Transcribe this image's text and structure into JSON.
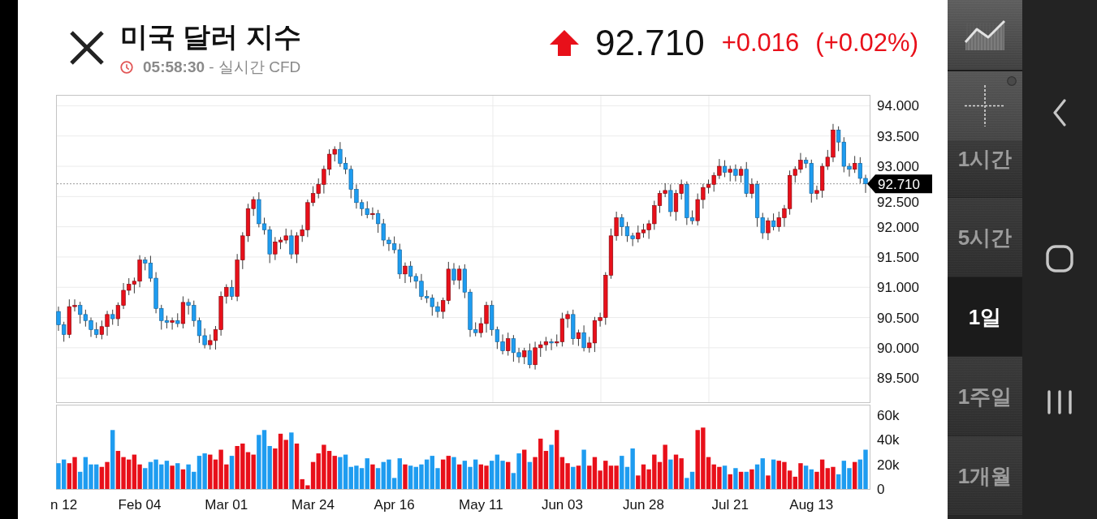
{
  "header": {
    "title": "미국 달러 지수",
    "subtitle": "**05:58:30** - 실시간 CFD"
  },
  "quote": {
    "rising": true,
    "price": "92.710",
    "change": "+0.016",
    "change_percent": "(+0.02%)"
  },
  "price_chart": {
    "chart_data": {
      "type": "candlestick",
      "categories": [
        "n 12",
        null,
        null,
        null,
        null,
        null,
        null,
        null,
        null,
        null,
        null,
        null,
        null,
        null,
        null,
        "Feb 04",
        null,
        null,
        null,
        null,
        null,
        null,
        null,
        null,
        null,
        null,
        null,
        null,
        null,
        null,
        null,
        "Mar 01",
        null,
        null,
        null,
        null,
        null,
        null,
        null,
        null,
        null,
        null,
        null,
        null,
        null,
        null,
        null,
        "Mar 24",
        null,
        null,
        null,
        null,
        null,
        null,
        null,
        null,
        null,
        null,
        null,
        null,
        null,
        null,
        "Apr 16",
        null,
        null,
        null,
        null,
        null,
        null,
        null,
        null,
        null,
        null,
        null,
        null,
        null,
        null,
        null,
        "May 11",
        null,
        null,
        null,
        null,
        null,
        null,
        null,
        null,
        null,
        null,
        null,
        null,
        null,
        null,
        "Jun 03",
        null,
        null,
        null,
        null,
        null,
        null,
        null,
        null,
        null,
        null,
        null,
        null,
        null,
        null,
        "Jun 28",
        null,
        null,
        null,
        null,
        null,
        null,
        null,
        null,
        null,
        null,
        null,
        null,
        null,
        null,
        null,
        "Jul 21",
        null,
        null,
        null,
        null,
        null,
        null,
        null,
        null,
        null,
        null,
        null,
        null,
        null,
        null,
        "Aug 13",
        null,
        null,
        null,
        null,
        null,
        null,
        null,
        null,
        null,
        null
      ],
      "ohlc": [
        [
          90.6,
          90.68,
          90.28,
          90.38
        ],
        [
          90.38,
          90.43,
          90.1,
          90.22
        ],
        [
          90.22,
          90.8,
          90.16,
          90.68
        ],
        [
          90.68,
          90.8,
          90.6,
          90.7
        ],
        [
          90.7,
          90.76,
          90.4,
          90.55
        ],
        [
          90.55,
          90.63,
          90.35,
          90.45
        ],
        [
          90.45,
          90.5,
          90.18,
          90.3
        ],
        [
          90.3,
          90.42,
          90.16,
          90.22
        ],
        [
          90.22,
          90.45,
          90.14,
          90.35
        ],
        [
          90.35,
          90.61,
          90.2,
          90.55
        ],
        [
          90.55,
          90.63,
          90.38,
          90.48
        ],
        [
          90.48,
          90.75,
          90.36,
          90.7
        ],
        [
          90.7,
          91.07,
          90.64,
          90.95
        ],
        [
          90.95,
          91.15,
          90.87,
          91.05
        ],
        [
          91.05,
          91.16,
          90.9,
          91.1
        ],
        [
          91.1,
          91.53,
          91.0,
          91.45
        ],
        [
          91.45,
          91.5,
          91.28,
          91.4
        ],
        [
          91.4,
          91.52,
          91.09,
          91.15
        ],
        [
          91.15,
          91.25,
          90.57,
          90.65
        ],
        [
          90.65,
          90.71,
          90.3,
          90.45
        ],
        [
          90.45,
          90.53,
          90.32,
          90.42
        ],
        [
          90.42,
          90.5,
          90.3,
          90.45
        ],
        [
          90.45,
          90.57,
          90.34,
          90.4
        ],
        [
          90.4,
          90.85,
          90.32,
          90.75
        ],
        [
          90.75,
          90.81,
          90.55,
          90.7
        ],
        [
          90.7,
          90.78,
          90.35,
          90.45
        ],
        [
          90.45,
          90.5,
          90.08,
          90.2
        ],
        [
          90.2,
          90.32,
          89.99,
          90.05
        ],
        [
          90.05,
          90.22,
          89.97,
          90.12
        ],
        [
          90.12,
          90.36,
          89.97,
          90.3
        ],
        [
          90.3,
          90.93,
          90.2,
          90.85
        ],
        [
          90.85,
          91.05,
          90.73,
          91.0
        ],
        [
          91.0,
          91.12,
          90.79,
          90.85
        ],
        [
          90.85,
          91.55,
          90.77,
          91.45
        ],
        [
          91.45,
          91.91,
          91.3,
          91.85
        ],
        [
          91.85,
          92.38,
          91.75,
          92.3
        ],
        [
          92.3,
          92.5,
          92.18,
          92.45
        ],
        [
          92.45,
          92.57,
          91.99,
          92.05
        ],
        [
          92.05,
          92.15,
          91.87,
          91.95
        ],
        [
          91.95,
          92.01,
          91.4,
          91.55
        ],
        [
          91.55,
          91.83,
          91.45,
          91.75
        ],
        [
          91.75,
          91.83,
          91.63,
          91.78
        ],
        [
          91.78,
          91.97,
          91.72,
          91.85
        ],
        [
          91.85,
          91.95,
          91.47,
          91.55
        ],
        [
          91.55,
          91.91,
          91.4,
          91.85
        ],
        [
          91.85,
          92.03,
          91.75,
          91.95
        ],
        [
          91.95,
          92.45,
          91.83,
          92.4
        ],
        [
          92.4,
          92.67,
          92.34,
          92.55
        ],
        [
          92.55,
          92.8,
          92.47,
          92.7
        ],
        [
          92.7,
          93.01,
          92.55,
          92.95
        ],
        [
          92.95,
          93.28,
          92.85,
          93.2
        ],
        [
          93.2,
          93.33,
          93.08,
          93.28
        ],
        [
          93.28,
          93.4,
          92.99,
          93.05
        ],
        [
          93.05,
          93.15,
          92.87,
          92.95
        ],
        [
          92.95,
          93.01,
          92.47,
          92.62
        ],
        [
          92.62,
          92.7,
          92.3,
          92.4
        ],
        [
          92.4,
          92.45,
          92.18,
          92.3
        ],
        [
          92.3,
          92.42,
          92.14,
          92.2
        ],
        [
          92.2,
          92.32,
          92.12,
          92.22
        ],
        [
          92.22,
          92.28,
          91.9,
          92.05
        ],
        [
          92.05,
          92.13,
          91.68,
          91.78
        ],
        [
          91.78,
          91.83,
          91.6,
          91.72
        ],
        [
          91.72,
          91.84,
          91.56,
          91.62
        ],
        [
          91.62,
          91.72,
          91.14,
          91.22
        ],
        [
          91.22,
          91.41,
          91.07,
          91.35
        ],
        [
          91.35,
          91.43,
          91.08,
          91.18
        ],
        [
          91.18,
          91.23,
          90.98,
          91.1
        ],
        [
          91.1,
          91.22,
          90.79,
          90.85
        ],
        [
          90.85,
          90.95,
          90.74,
          90.82
        ],
        [
          90.82,
          90.88,
          90.53,
          90.68
        ],
        [
          90.68,
          90.76,
          90.5,
          90.6
        ],
        [
          90.6,
          90.83,
          90.48,
          90.78
        ],
        [
          90.78,
          91.42,
          90.72,
          91.3
        ],
        [
          91.3,
          91.4,
          91.04,
          91.12
        ],
        [
          91.12,
          91.36,
          90.97,
          91.3
        ],
        [
          91.3,
          91.38,
          90.82,
          90.92
        ],
        [
          90.92,
          90.97,
          90.18,
          90.3
        ],
        [
          90.3,
          90.42,
          90.19,
          90.25
        ],
        [
          90.25,
          90.5,
          90.17,
          90.4
        ],
        [
          90.4,
          90.76,
          90.25,
          90.7
        ],
        [
          90.7,
          90.78,
          90.2,
          90.3
        ],
        [
          90.3,
          90.35,
          89.98,
          90.1
        ],
        [
          90.1,
          90.22,
          89.89,
          89.95
        ],
        [
          89.95,
          90.25,
          89.87,
          90.15
        ],
        [
          90.15,
          90.21,
          89.77,
          89.92
        ],
        [
          89.92,
          90.0,
          89.75,
          89.85
        ],
        [
          89.85,
          90.0,
          89.73,
          89.95
        ],
        [
          89.95,
          90.07,
          89.66,
          89.72
        ],
        [
          89.72,
          90.1,
          89.64,
          90.0
        ],
        [
          90.0,
          90.11,
          89.85,
          90.05
        ],
        [
          90.05,
          90.18,
          89.95,
          90.1
        ],
        [
          90.1,
          90.15,
          89.96,
          90.08
        ],
        [
          90.08,
          90.22,
          90.02,
          90.1
        ],
        [
          90.1,
          90.58,
          90.02,
          90.48
        ],
        [
          90.48,
          90.61,
          90.33,
          90.55
        ],
        [
          90.55,
          90.63,
          90.05,
          90.15
        ],
        [
          90.15,
          90.3,
          90.03,
          90.25
        ],
        [
          90.25,
          90.37,
          89.94,
          90.0
        ],
        [
          90.0,
          90.18,
          89.92,
          90.08
        ],
        [
          90.08,
          90.51,
          89.93,
          90.45
        ],
        [
          90.45,
          90.58,
          90.35,
          90.5
        ],
        [
          90.5,
          91.25,
          90.38,
          91.2
        ],
        [
          91.2,
          91.97,
          91.14,
          91.85
        ],
        [
          91.85,
          92.25,
          91.77,
          92.15
        ],
        [
          92.15,
          92.21,
          91.85,
          92.0
        ],
        [
          92.0,
          92.08,
          91.75,
          91.85
        ],
        [
          91.85,
          91.9,
          91.68,
          91.8
        ],
        [
          91.8,
          92.02,
          91.74,
          91.9
        ],
        [
          91.9,
          92.05,
          91.82,
          91.95
        ],
        [
          91.95,
          92.11,
          91.8,
          92.05
        ],
        [
          92.05,
          92.43,
          91.95,
          92.35
        ],
        [
          92.35,
          92.6,
          92.23,
          92.55
        ],
        [
          92.55,
          92.72,
          92.49,
          92.6
        ],
        [
          92.6,
          92.7,
          92.17,
          92.25
        ],
        [
          92.25,
          92.61,
          92.1,
          92.55
        ],
        [
          92.55,
          92.78,
          92.45,
          92.7
        ],
        [
          92.7,
          92.75,
          92.03,
          92.15
        ],
        [
          92.15,
          92.27,
          92.04,
          92.1
        ],
        [
          92.1,
          92.55,
          92.02,
          92.45
        ],
        [
          92.45,
          92.71,
          92.3,
          92.65
        ],
        [
          92.65,
          92.78,
          92.55,
          92.7
        ],
        [
          92.7,
          92.9,
          92.58,
          92.85
        ],
        [
          92.85,
          93.12,
          92.79,
          93.0
        ],
        [
          93.0,
          93.1,
          92.82,
          92.9
        ],
        [
          92.9,
          93.01,
          92.75,
          92.95
        ],
        [
          92.95,
          93.03,
          92.75,
          92.85
        ],
        [
          92.85,
          93.0,
          92.73,
          92.95
        ],
        [
          92.95,
          93.07,
          92.49,
          92.55
        ],
        [
          92.55,
          92.8,
          92.47,
          92.7
        ],
        [
          92.7,
          92.76,
          92.0,
          92.15
        ],
        [
          92.15,
          92.23,
          91.8,
          91.9
        ],
        [
          91.9,
          92.15,
          91.78,
          92.1
        ],
        [
          92.1,
          92.22,
          91.94,
          92.0
        ],
        [
          92.0,
          92.25,
          91.92,
          92.15
        ],
        [
          92.15,
          92.36,
          92.0,
          92.3
        ],
        [
          92.3,
          92.93,
          92.2,
          92.85
        ],
        [
          92.85,
          93.0,
          92.73,
          92.95
        ],
        [
          92.95,
          93.22,
          92.89,
          93.1
        ],
        [
          93.1,
          93.15,
          92.97,
          93.05
        ],
        [
          93.05,
          93.11,
          92.4,
          92.55
        ],
        [
          92.55,
          92.68,
          92.45,
          92.6
        ],
        [
          92.6,
          93.05,
          92.48,
          93.0
        ],
        [
          93.0,
          93.27,
          92.94,
          93.15
        ],
        [
          93.15,
          93.7,
          93.07,
          93.6
        ],
        [
          93.6,
          93.66,
          93.25,
          93.4
        ],
        [
          93.4,
          93.48,
          92.9,
          93.0
        ],
        [
          93.0,
          93.05,
          92.83,
          92.95
        ],
        [
          92.95,
          93.17,
          92.89,
          93.05
        ],
        [
          93.05,
          93.15,
          92.72,
          92.8
        ],
        [
          92.8,
          92.86,
          92.56,
          92.71
        ]
      ],
      "ylim": [
        89.1,
        94.18
      ],
      "yticks": [
        {
          "value": 94,
          "label": "94.000"
        },
        {
          "value": 93.5,
          "label": "93.500"
        },
        {
          "value": 93,
          "label": "93.000"
        },
        {
          "value": 92.5,
          "label": "92.500"
        },
        {
          "value": 92,
          "label": "92.000"
        },
        {
          "value": 91.5,
          "label": "91.500"
        },
        {
          "value": 91,
          "label": "91.000"
        },
        {
          "value": 90.5,
          "label": "90.500"
        },
        {
          "value": 90,
          "label": "90.000"
        },
        {
          "value": 89.5,
          "label": "89.500"
        }
      ],
      "grid": true,
      "ref_lines": [
        {
          "axis": "y",
          "value": 92.71,
          "label": "92.710"
        }
      ]
    }
  },
  "volume_chart": {
    "chart_data": {
      "type": "bar",
      "categories": [
        null,
        null,
        null,
        null,
        null,
        null,
        null,
        null,
        null,
        null,
        null,
        null,
        null,
        null,
        null,
        null,
        null,
        null,
        null,
        null,
        null,
        null,
        null,
        null,
        null,
        null,
        null,
        null,
        null,
        null,
        null,
        null,
        null,
        null,
        null,
        null,
        null,
        null,
        null,
        null,
        null,
        null,
        null,
        null,
        null,
        null,
        null,
        null,
        null,
        null,
        null,
        null,
        null,
        null,
        null,
        null,
        null,
        null,
        null,
        null,
        null,
        null,
        null,
        null,
        null,
        null,
        null,
        null,
        null,
        null,
        null,
        null,
        null,
        null,
        null,
        null,
        null,
        null,
        null,
        null,
        null,
        null,
        null,
        null,
        null,
        null,
        null,
        null,
        null,
        null,
        null,
        null,
        null,
        null,
        null,
        null,
        null,
        null,
        null,
        null,
        null,
        null,
        null,
        null,
        null,
        null,
        null,
        null,
        null,
        null,
        null,
        null,
        null,
        null,
        null,
        null,
        null,
        null,
        null,
        null,
        null,
        null,
        null,
        null,
        null,
        null,
        null,
        null,
        null,
        null,
        null,
        null,
        null,
        null,
        null,
        null,
        null,
        null,
        null,
        null,
        null,
        null,
        null,
        null,
        null,
        null,
        null,
        null,
        null,
        null
      ],
      "values": [
        21000,
        24000,
        21000,
        26000,
        14000,
        26000,
        20000,
        20000,
        18000,
        22000,
        48000,
        31000,
        26000,
        24000,
        28000,
        20000,
        17000,
        22000,
        24000,
        20000,
        23000,
        19000,
        21000,
        16000,
        20000,
        14000,
        27000,
        29000,
        28000,
        24000,
        32000,
        20000,
        27000,
        35000,
        37000,
        30000,
        28000,
        44000,
        48000,
        35000,
        33000,
        45000,
        40000,
        46000,
        37000,
        8000,
        3000,
        22000,
        29000,
        36000,
        31000,
        27000,
        26000,
        28000,
        18000,
        19000,
        17000,
        25000,
        20000,
        17000,
        22000,
        24000,
        9000,
        25000,
        20000,
        19000,
        18000,
        20000,
        24000,
        27000,
        17000,
        24000,
        27000,
        26000,
        20000,
        23000,
        18000,
        24000,
        20000,
        19000,
        23000,
        28000,
        23000,
        22000,
        13000,
        29000,
        32000,
        22000,
        26000,
        41000,
        31000,
        36000,
        48000,
        26000,
        21000,
        18000,
        19000,
        32000,
        19000,
        26000,
        15000,
        23000,
        19000,
        19000,
        27000,
        18000,
        33000,
        11000,
        20000,
        16000,
        28000,
        22000,
        36000,
        24000,
        28000,
        25000,
        9000,
        14000,
        48000,
        50000,
        26000,
        20000,
        18000,
        19000,
        12000,
        17000,
        14000,
        14000,
        16000,
        20000,
        25000,
        11000,
        24000,
        23000,
        22000,
        15000,
        10000,
        21000,
        19000,
        16000,
        14000,
        24000,
        17000,
        18000,
        12000,
        23000,
        17000,
        22000,
        24000,
        32000
      ],
      "ylim": [
        0,
        68000
      ],
      "yticks": [
        {
          "value": 60000,
          "label": "60k"
        },
        {
          "value": 40000,
          "label": "40k"
        },
        {
          "value": 20000,
          "label": "20k"
        },
        {
          "value": 0,
          "label": "0"
        }
      ]
    }
  },
  "timeframes": [
    {
      "label": "1시간",
      "selected": false
    },
    {
      "label": "5시간",
      "selected": false
    },
    {
      "label": "1일",
      "selected": true
    },
    {
      "label": "1주일",
      "selected": false
    },
    {
      "label": "1개월",
      "selected": false
    }
  ]
}
